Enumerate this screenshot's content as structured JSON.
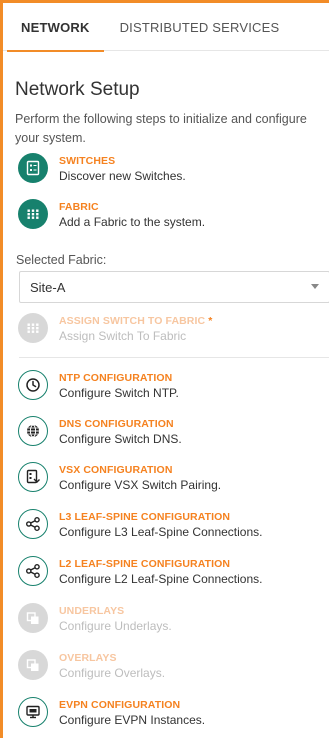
{
  "tabs": {
    "network": "NETWORK",
    "distributed": "DISTRIBUTED SERVICES"
  },
  "setup": {
    "title": "Network Setup",
    "intro": "Perform the following steps to initialize and configure your system."
  },
  "switches": {
    "title": "SWITCHES",
    "desc": "Discover new Switches."
  },
  "fabric": {
    "title": "FABRIC",
    "desc": "Add a Fabric to the system."
  },
  "fabric_select": {
    "label": "Selected Fabric:",
    "value": "Site-A"
  },
  "assign": {
    "title": "ASSIGN SWITCH TO FABRIC",
    "required_mark": "*",
    "desc": "Assign Switch To Fabric"
  },
  "ntp": {
    "title": "NTP CONFIGURATION",
    "desc": "Configure Switch NTP."
  },
  "dns": {
    "title": "DNS CONFIGURATION",
    "desc": "Configure Switch DNS."
  },
  "vsx": {
    "title": "VSX CONFIGURATION",
    "desc": "Configure VSX Switch Pairing."
  },
  "l3": {
    "title": "L3 LEAF-SPINE CONFIGURATION",
    "desc": "Configure L3 Leaf-Spine Connections."
  },
  "l2": {
    "title": "L2 LEAF-SPINE CONFIGURATION",
    "desc": "Configure L2 Leaf-Spine Connections."
  },
  "underlays": {
    "title": "UNDERLAYS",
    "desc": "Configure Underlays."
  },
  "overlays": {
    "title": "OVERLAYS",
    "desc": "Configure Overlays."
  },
  "evpn": {
    "title": "EVPN CONFIGURATION",
    "desc": "Configure EVPN Instances."
  },
  "colors": {
    "accent_orange": "#f58220",
    "step_green": "#17816d",
    "disabled_gray": "#d8d8d8"
  },
  "icons": {
    "switches": "switch-list-icon",
    "fabric": "grid-icon",
    "assign": "grid-icon",
    "ntp": "clock-icon",
    "dns": "globe-icon",
    "vsx": "pairing-icon",
    "l3": "share-nodes-icon",
    "l2": "share-nodes-icon",
    "underlays": "layers-icon",
    "overlays": "layers-icon",
    "evpn": "monitor-icon"
  }
}
